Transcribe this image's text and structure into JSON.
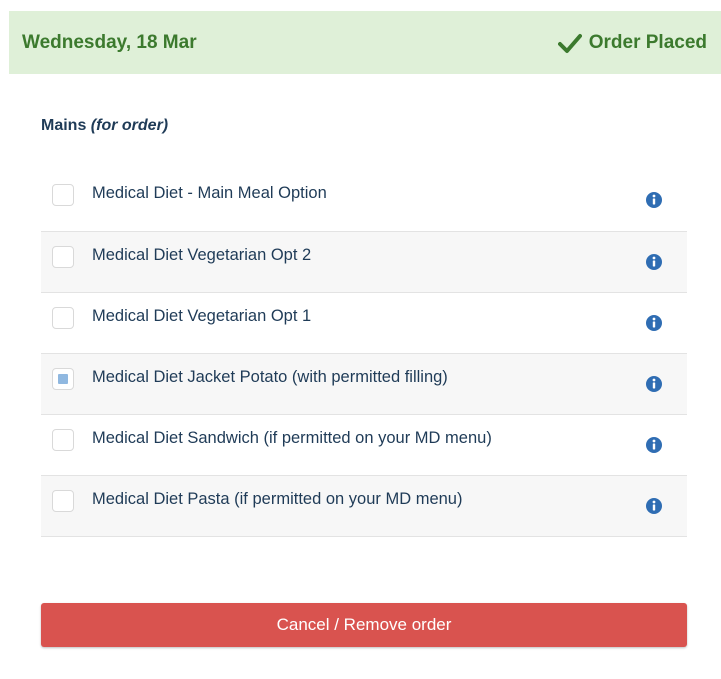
{
  "header": {
    "date": "Wednesday, 18 Mar",
    "status": "Order Placed",
    "status_icon": "check-icon",
    "background_color": "#dff0d8",
    "text_color": "#3c7a2e"
  },
  "section": {
    "title": "Mains",
    "subtitle": "(for order)"
  },
  "items": [
    {
      "label": "Medical Diet - Main Meal Option",
      "checked": false
    },
    {
      "label": "Medical Diet Vegetarian Opt 2",
      "checked": false
    },
    {
      "label": "Medical Diet Vegetarian Opt 1",
      "checked": false
    },
    {
      "label": "Medical Diet Jacket Potato (with permitted filling)",
      "checked": true
    },
    {
      "label": "Medical Diet Sandwich (if permitted on your MD menu)",
      "checked": false
    },
    {
      "label": "Medical Diet Pasta (if permitted on your MD menu)",
      "checked": false
    }
  ],
  "info_icon": "info-icon",
  "info_icon_color": "#2f6db3",
  "actions": {
    "cancel_label": "Cancel / Remove order",
    "cancel_color": "#d9534f"
  }
}
